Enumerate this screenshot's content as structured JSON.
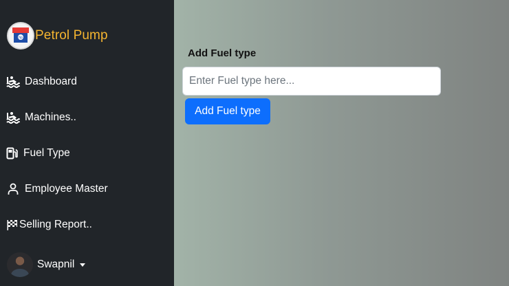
{
  "sidebar": {
    "brand": {
      "title": "Petrol Pump",
      "logo_icon": "hp-logo-icon",
      "title_color": "#f5b530"
    },
    "items": [
      {
        "label": "Dashboard",
        "icon": "water-waves-icon"
      },
      {
        "label": "Machines..",
        "icon": "water-waves-icon"
      },
      {
        "label": "Fuel Type",
        "icon": "fuel-pump-icon"
      },
      {
        "label": "Employee Master",
        "icon": "person-icon"
      },
      {
        "label": "Selling Report..",
        "icon": "checkered-flag-icon"
      }
    ],
    "user": {
      "name": "Swapnil",
      "icon": "caret-down-icon"
    },
    "background": "#212529"
  },
  "main": {
    "form": {
      "label": "Add Fuel type",
      "input_value": "",
      "input_placeholder": "Enter Fuel type here...",
      "button_label": "Add Fuel type",
      "button_color": "#0d6efd"
    }
  }
}
